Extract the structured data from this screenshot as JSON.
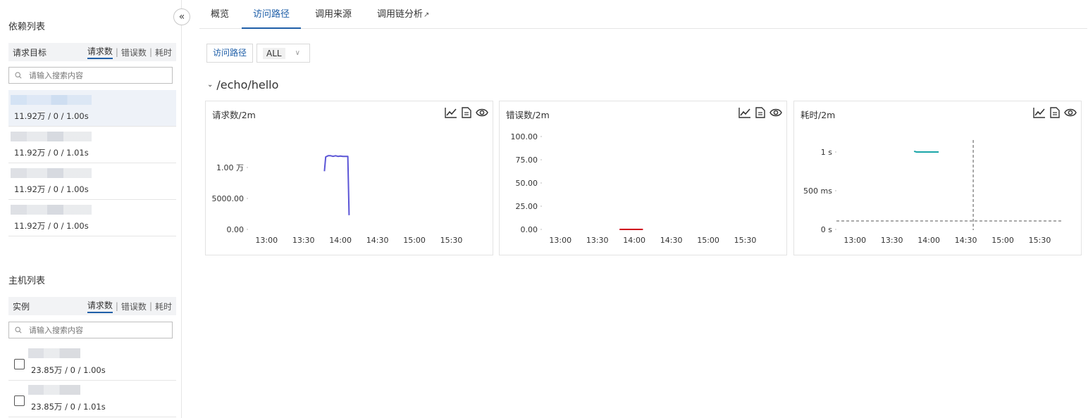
{
  "sidebar": {
    "collapse_icon": "double-chevron-left-icon",
    "dependencies": {
      "title": "依赖列表",
      "header_label": "请求目标",
      "sort_tabs": [
        "请求数",
        "错误数",
        "耗时"
      ],
      "active_sort": "请求数",
      "search_placeholder": "请输入搜索内容",
      "items": [
        {
          "metric": "11.92万 / 0 / 1.00s",
          "selected": true
        },
        {
          "metric": "11.92万 / 0 / 1.01s",
          "selected": false
        },
        {
          "metric": "11.92万 / 0 / 1.00s",
          "selected": false
        },
        {
          "metric": "11.92万 / 0 / 1.00s",
          "selected": false
        }
      ]
    },
    "hosts": {
      "title": "主机列表",
      "header_label": "实例",
      "sort_tabs": [
        "请求数",
        "错误数",
        "耗时"
      ],
      "search_placeholder": "请输入搜索内容",
      "items": [
        {
          "metric": "23.85万 / 0 / 1.00s",
          "checked": false
        },
        {
          "metric": "23.85万 / 0 / 1.01s",
          "checked": false
        }
      ]
    }
  },
  "tabs": [
    {
      "label": "概览",
      "active": false
    },
    {
      "label": "访问路径",
      "active": true
    },
    {
      "label": "调用来源",
      "active": false
    },
    {
      "label": "调用链分析",
      "active": false,
      "external": true
    }
  ],
  "filter": {
    "label": "访问路径",
    "value": "ALL"
  },
  "group": {
    "title": "/echo/hello"
  },
  "chart_data": [
    {
      "type": "line",
      "title": "请求数/2m",
      "x_ticks": [
        "13:00",
        "13:30",
        "14:00",
        "14:30",
        "15:00",
        "15:30"
      ],
      "y_ticks": [
        "0.00",
        "5000.00",
        "1.00 万"
      ],
      "ylim": [
        0,
        15000
      ],
      "color": "#5b55d6",
      "series": [
        {
          "x": [
            "13:47",
            "13:48",
            "13:50",
            "13:52",
            "13:54",
            "13:56",
            "13:58",
            "14:00",
            "14:02",
            "14:04",
            "14:06",
            "14:07"
          ],
          "values": [
            9400,
            11700,
            11900,
            11900,
            11800,
            11900,
            11800,
            11850,
            11800,
            11800,
            11800,
            2300
          ]
        }
      ]
    },
    {
      "type": "line",
      "title": "错误数/2m",
      "x_ticks": [
        "13:00",
        "13:30",
        "14:00",
        "14:30",
        "15:00",
        "15:30"
      ],
      "y_ticks": [
        "0.00",
        "25.00",
        "50.00",
        "75.00",
        "100.00"
      ],
      "ylim": [
        0,
        100
      ],
      "color": "#d0021b",
      "series": [
        {
          "x": [
            "13:48",
            "14:07"
          ],
          "values": [
            0,
            0
          ]
        }
      ]
    },
    {
      "type": "line",
      "title": "耗时/2m",
      "x_ticks": [
        "13:00",
        "13:30",
        "14:00",
        "14:30",
        "15:00",
        "15:30"
      ],
      "y_ticks": [
        "0 s",
        "500 ms",
        "1 s"
      ],
      "ylim": [
        0,
        1200
      ],
      "color": "#1aa5a8",
      "crosshair": {
        "x": "14:36"
      },
      "series": [
        {
          "x": [
            "13:48",
            "13:50",
            "13:54",
            "14:00",
            "14:04",
            "14:08"
          ],
          "values": [
            1010,
            1000,
            1000,
            1000,
            1000,
            1000
          ]
        }
      ]
    }
  ],
  "chart_action_icons": [
    "line-chart-icon",
    "document-icon",
    "eye-icon"
  ]
}
